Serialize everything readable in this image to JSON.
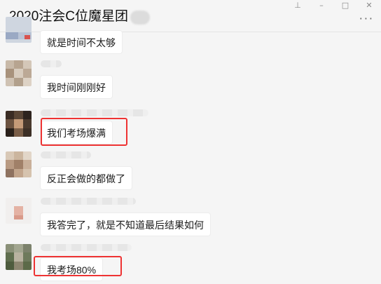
{
  "window": {
    "title": "2020注会C位魔星团",
    "controls": [
      "pin-icon",
      "minimize-icon",
      "maximize-icon",
      "close-icon"
    ],
    "more_icon": "more-icon"
  },
  "messages": [
    {
      "text": "就是时间不太够",
      "highlighted": false
    },
    {
      "text": "我时间刚刚好",
      "highlighted": false
    },
    {
      "text": "我们考场爆满",
      "highlighted": true
    },
    {
      "text": "反正会做的都做了",
      "highlighted": false
    },
    {
      "text": "我答完了，就是不知道最后结果如何",
      "highlighted": false
    },
    {
      "text": "我考场80%",
      "highlighted": true
    }
  ],
  "colors": {
    "highlight_border": "#e33333",
    "bubble": "#ffffff",
    "background": "#f5f5f5"
  }
}
